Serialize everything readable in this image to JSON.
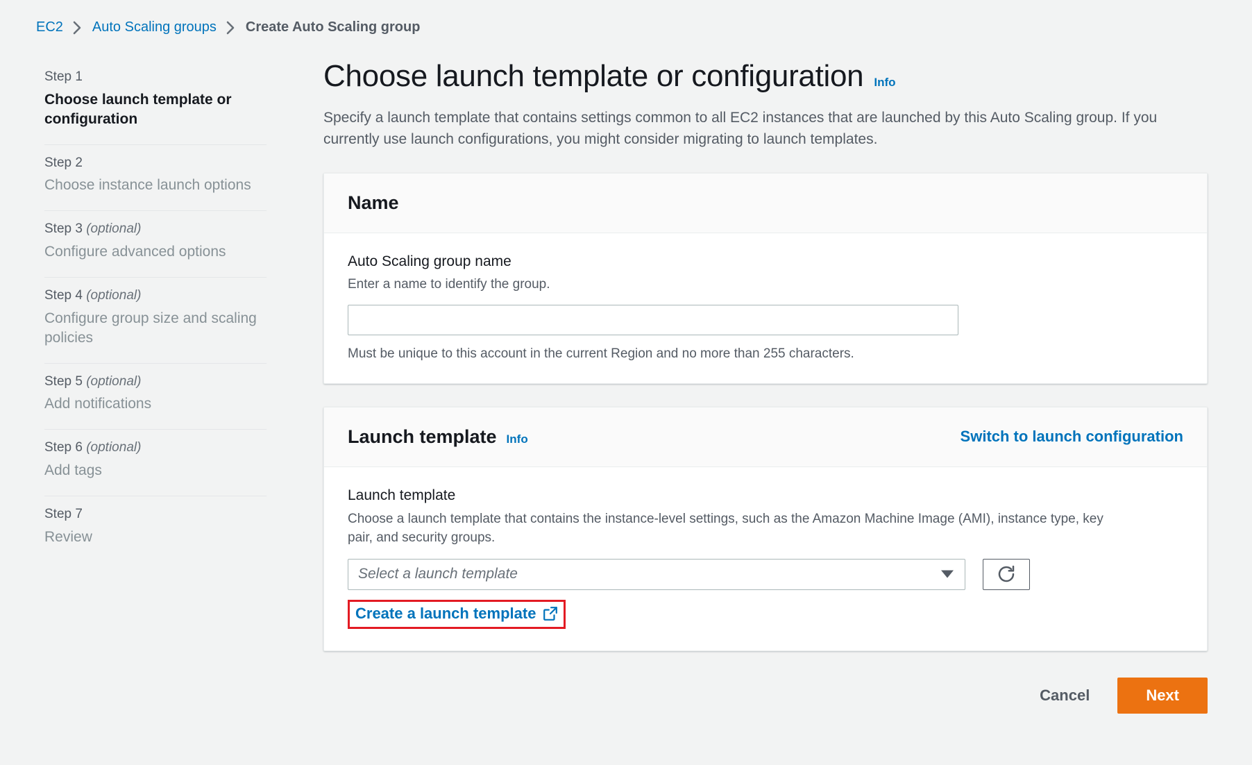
{
  "breadcrumb": {
    "items": [
      {
        "label": "EC2",
        "current": false
      },
      {
        "label": "Auto Scaling groups",
        "current": false
      },
      {
        "label": "Create Auto Scaling group",
        "current": true
      }
    ]
  },
  "sidebar": {
    "steps": [
      {
        "num": "Step 1",
        "optional": "",
        "title": "Choose launch template or configuration",
        "active": true
      },
      {
        "num": "Step 2",
        "optional": "",
        "title": "Choose instance launch options",
        "active": false
      },
      {
        "num": "Step 3",
        "optional": "(optional)",
        "title": "Configure advanced options",
        "active": false
      },
      {
        "num": "Step 4",
        "optional": "(optional)",
        "title": "Configure group size and scaling policies",
        "active": false
      },
      {
        "num": "Step 5",
        "optional": "(optional)",
        "title": "Add notifications",
        "active": false
      },
      {
        "num": "Step 6",
        "optional": "(optional)",
        "title": "Add tags",
        "active": false
      },
      {
        "num": "Step 7",
        "optional": "",
        "title": "Review",
        "active": false
      }
    ]
  },
  "main": {
    "title": "Choose launch template or configuration",
    "title_info_label": "Info",
    "description": "Specify a launch template that contains settings common to all EC2 instances that are launched by this Auto Scaling group. If you currently use launch configurations, you might consider migrating to launch templates."
  },
  "name_card": {
    "header_title": "Name",
    "field_label": "Auto Scaling group name",
    "field_description": "Enter a name to identify the group.",
    "field_value": "",
    "field_placeholder": "",
    "constraint": "Must be unique to this account in the current Region and no more than 255 characters."
  },
  "launch_template_card": {
    "header_title": "Launch template",
    "header_info_label": "Info",
    "header_action_label": "Switch to launch configuration",
    "field_label": "Launch template",
    "field_description": "Choose a launch template that contains the instance-level settings, such as the Amazon Machine Image (AMI), instance type, key pair, and security groups.",
    "select_placeholder": "Select a launch template",
    "select_value": "",
    "refresh_icon": "refresh-icon",
    "create_link_label": "Create a launch template",
    "create_link_icon": "external-link-icon"
  },
  "footer": {
    "cancel_label": "Cancel",
    "next_label": "Next"
  },
  "colors": {
    "page_background": "#f2f3f3",
    "link_blue": "#0073bb",
    "primary_orange": "#ec7211",
    "annotation_red": "#e31b23",
    "text_dark": "#16191f",
    "text_muted": "#545b64",
    "text_disabled": "#879196"
  }
}
